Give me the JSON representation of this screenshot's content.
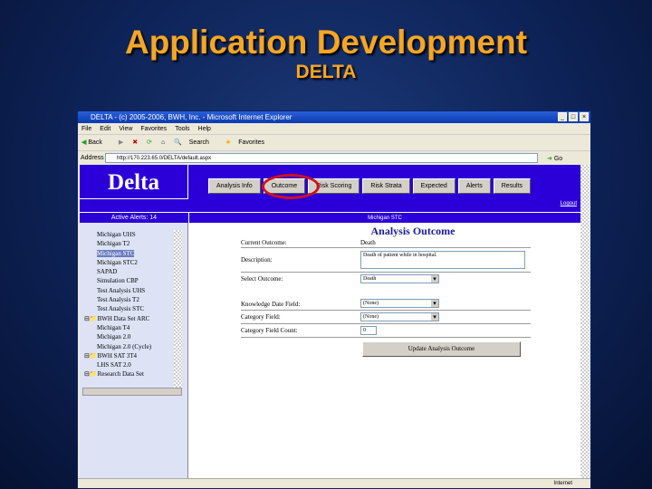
{
  "slide": {
    "title": "Application Development",
    "subtitle": "DELTA"
  },
  "browser": {
    "title": "DELTA - (c) 2005-2006, BWH, Inc. - Microsoft Internet Explorer",
    "menu": [
      "File",
      "Edit",
      "View",
      "Favorites",
      "Tools",
      "Help"
    ],
    "toolbar": [
      "Back",
      "Search",
      "Favorites"
    ],
    "address_label": "Address",
    "address": "http://170.223.65.0/DELTA/default.aspx",
    "go": "Go",
    "status": "Internet"
  },
  "app": {
    "logo": "Delta",
    "nav": [
      "Analysis Info",
      "Outcome",
      "Risk Scoring",
      "Risk Strata",
      "Expected",
      "Alerts",
      "Results"
    ],
    "logout": "Logout",
    "active_alerts": "Active Alerts: 14",
    "context": "Michigan STC",
    "tree": [
      "Michigan UHS",
      "Michigan T2",
      "Michigan STC",
      "Michigan STC2",
      "SAPAD",
      "Simulation CBP",
      "Test Analysis UHS",
      "Test Analysis T2",
      "Test Analysis STC",
      "BWH Data Set ARC",
      "Michigan T4",
      "Michigan 2.0",
      "Michigan 2.0 (Cycle)",
      "BWH SAT 3T4",
      "LHS SAT 2.0",
      "Research Data Set"
    ],
    "selected_tree_item": "Michigan STC",
    "form": {
      "heading": "Analysis Outcome",
      "current_outcome_label": "Current Outcome:",
      "current_outcome": "Death",
      "description_label": "Description:",
      "description": "Death of patient while in hospital.",
      "select_outcome_label": "Select Outcome:",
      "select_outcome": "Death",
      "knowledge_date_label": "Knowledge Date Field:",
      "knowledge_date": "(None)",
      "category_field_label": "Category Field:",
      "category_field": "(None)",
      "category_count_label": "Category Field Count:",
      "category_count": "0",
      "update_button": "Update Analysis Outcome"
    }
  }
}
